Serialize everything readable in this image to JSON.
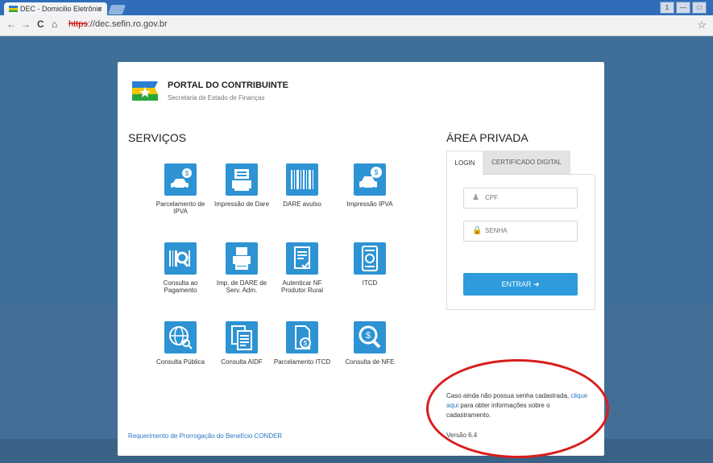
{
  "browser": {
    "tab_title": "DEC - Domicilio Eletrônic",
    "tab_close": "×",
    "url_scheme": "https",
    "url_rest": "://dec.sefin.ro.gov.br",
    "back": "←",
    "forward": "→",
    "reload": "C",
    "home": "⌂",
    "star": "☆",
    "window_buttons": [
      "1",
      "—",
      "□"
    ]
  },
  "header": {
    "title": "PORTAL DO CONTRIBUINTE",
    "subtitle": "Secretaria de Estado de Finanças"
  },
  "services": {
    "heading": "SERVIÇOS",
    "items": [
      {
        "label": "Parcelamento de IPVA",
        "icon": "car-coin-icon"
      },
      {
        "label": "Impressão de Dare",
        "icon": "printer-icon"
      },
      {
        "label": "DARE avulso",
        "icon": "barcode-icon"
      },
      {
        "label": "Impressão IPVA",
        "icon": "car-coin-icon"
      },
      {
        "label": "Consulta ao Pagamento",
        "icon": "barcode-search-icon"
      },
      {
        "label": "Imp. de DARE de Serv. Adm.",
        "icon": "printer-icon"
      },
      {
        "label": "Autenticar NF Produtor Rural",
        "icon": "document-check-icon"
      },
      {
        "label": "ITCD",
        "icon": "document-icon"
      },
      {
        "label": "Consulta Pública",
        "icon": "globe-search-icon"
      },
      {
        "label": "Consulta AIDF",
        "icon": "documents-icon"
      },
      {
        "label": "Parcelamento ITCD",
        "icon": "document-coin-icon"
      },
      {
        "label": "Consulta de NFE",
        "icon": "coin-search-icon"
      }
    ],
    "link": "Requerimento de Prorrogação do Benefício CONDER"
  },
  "private_area": {
    "heading": "ÁREA PRIVADA",
    "tab_login": "LOGIN",
    "tab_certificate": "CERTIFICADO DIGITAL",
    "cpf_placeholder": "CPF",
    "password_placeholder": "SENHA",
    "enter_label": "ENTRAR ➜"
  },
  "info": {
    "text_before": "Caso ainda não possua senha cadastrada, ",
    "link_text": "clique aqui",
    "text_after": " para obter informações sobre o cadastramento.",
    "version": "Versão 6.4"
  },
  "colors": {
    "accent": "#2e93d3",
    "annotation": "#d81e1e"
  }
}
